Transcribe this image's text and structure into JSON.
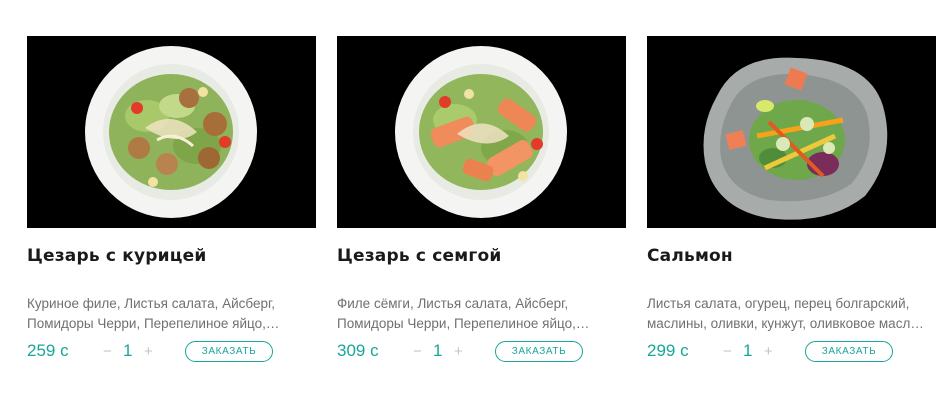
{
  "products": [
    {
      "title": "Цезарь с курицей",
      "description": "Куриное филе, Листья салата, Айсберг, Помидоры Черри, Перепелиное яйцо,…",
      "price": "259 с",
      "qty": "1",
      "minus": "−",
      "plus": "+",
      "order_label": "ЗАКАЗАТЬ",
      "image": "caesar-chicken-salad-photo"
    },
    {
      "title": "Цезарь с семгой",
      "description": "Филе сёмги, Листья салата, Айсберг, Помидоры Черри, Перепелиное яйцо,…",
      "price": "309 с",
      "qty": "1",
      "minus": "−",
      "plus": "+",
      "order_label": "ЗАКАЗАТЬ",
      "image": "caesar-salmon-salad-photo"
    },
    {
      "title": "Сальмон",
      "description": "Листья салата, огурец, перец болгарский, маслины, оливки, кунжут, оливковое масл…",
      "price": "299 с",
      "qty": "1",
      "minus": "−",
      "plus": "+",
      "order_label": "ЗАКАЗАТЬ",
      "image": "salmon-salad-photo"
    }
  ],
  "colors": {
    "accent": "#1aa59a",
    "text": "#1a1a1a",
    "muted": "#707070"
  }
}
